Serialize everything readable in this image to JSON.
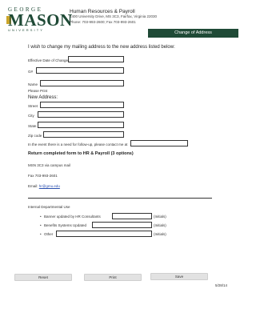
{
  "header": {
    "logo_top": "GEORGE",
    "logo_main": "MASON",
    "logo_bottom": "UNIVERSITY",
    "office": "Human Resources & Payroll",
    "address": "4400 University Drive, MS 3C3, Fairfax, Virginia 22030",
    "phone": "Phone: 703-993-2600; Fax 703-993-2601",
    "form_title": "Change of Address"
  },
  "form": {
    "intro": "I wish to change my mailing address to the new address listed below:",
    "effective_date_label": "Effective Date of Change",
    "gid_label": "G#",
    "name_label": "Name",
    "please_print": "Please Print",
    "new_address_heading": "New Address:",
    "street_label": "Street",
    "city_label": "City",
    "state_label": "State",
    "zip_label": "Zip code",
    "followup_text": "In the event there is a need for follow-up, please contact me at",
    "return_heading": "Return completed form to HR & Payroll (3 options)",
    "option_mail": "MSN 3C3 via campus mail",
    "option_fax": "Fax 703-993-2601",
    "option_email_prefix": "Email: ",
    "option_email": "hr@gmu.edu"
  },
  "departmental": {
    "heading": "Internal Departmental Use",
    "items": [
      {
        "label": "Banner updated by HR Consultants",
        "initials_label": "(Initials)"
      },
      {
        "label": "Benefits Systems Updated",
        "initials_label": "(Initials)"
      },
      {
        "label": "Other",
        "initials_label": "(Initials)"
      }
    ]
  },
  "buttons": {
    "reset": "Reset",
    "print": "Print",
    "save": "Save"
  },
  "revision_date": "5/28/14",
  "colors": {
    "brand_green": "#1f4a36",
    "brand_gold": "#c9a42a"
  }
}
